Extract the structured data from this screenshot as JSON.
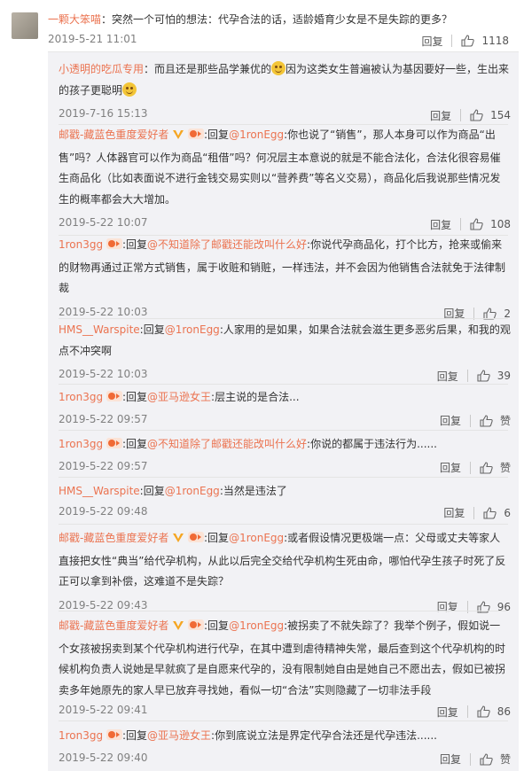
{
  "top": {
    "author": "一颗大笨喵",
    "text": "：突然一个可怕的想法：代孕合法的话，适龄婚育少女是不是失踪的更多？",
    "time": "2019-5-21 11:01",
    "reply_label": "回复",
    "likes": "1118"
  },
  "replies": [
    {
      "author": "小透明的吃瓜专用",
      "pre": "：而且还是那些品学兼优的",
      "mid": "因为这类女生普遍被认为基因要好一些，生出来的孩子更聪明",
      "time": "2019-7-16 15:13",
      "likes": "154"
    },
    {
      "author": "邮戳-藏蓝色重度爱好者",
      "at": "@1ronEgg",
      "text": ":你也说了“销售”，那人本身可以作为商品“出售”吗？人体器官可以作为商品“租借”吗？何况层主本意说的就是不能合法化，合法化很容易催生商品化（比如表面说不进行金钱交易实则以“营养费”等名义交易），商品化后我说那些情况发生的概率都会大大增加。",
      "time": "2019-5-22 10:07",
      "likes": "108"
    },
    {
      "author": "1ron3gg",
      "at": "@不知道除了邮戳还能改叫什么好",
      "text": ":你说代孕商品化，打个比方，抢来或偷来的财物再通过正常方式销售，属于收赃和销赃，一样违法，并不会因为他销售合法就免于法律制裁",
      "time": "2019-5-22 10:03",
      "likes": "2"
    },
    {
      "author": "HMS__Warspite",
      "at": "@1ronEgg",
      "text": ":人家用的是如果，如果合法就会滋生更多恶劣后果，和我的观点不冲突啊",
      "time": "2019-5-22 10:03",
      "likes": "39"
    },
    {
      "author": "1ron3gg",
      "at": "@亚马逊女王",
      "text": ":层主说的是合法...",
      "time": "2019-5-22 09:57",
      "likes": "赞"
    },
    {
      "author": "1ron3gg",
      "at": "@不知道除了邮戳还能改叫什么好",
      "text": ":你说的都属于违法行为......",
      "time": "2019-5-22 09:57",
      "likes": "赞"
    },
    {
      "author": "HMS__Warspite",
      "at": "@1ronEgg",
      "text": ":当然是违法了",
      "time": "2019-5-22 09:48",
      "likes": "6"
    },
    {
      "author": "邮戳-藏蓝色重度爱好者",
      "at": "@1ronEgg",
      "text": ":或者假设情况更极端一点：父母或丈夫等家人直接把女性“典当”给代孕机构，从此以后完全交给代孕机构生死由命，哪怕代孕生孩子时死了反正可以拿到补偿，这难道不是失踪？",
      "time": "2019-5-22 09:43",
      "likes": "96"
    },
    {
      "author": "邮戳-藏蓝色重度爱好者",
      "at": "@1ronEgg",
      "text": ":被拐卖了不就失踪了？我举个例子，假如说一个女孩被拐卖到某个代孕机构进行代孕，在其中遭到虐待精神失常，最后查到这个代孕机构的时候机构负责人说她是早就疯了是自愿来代孕的，没有限制她自由是她自己不愿出去，假如已被拐卖多年她原先的家人早已放弃寻找她，看似一切“合法”实则隐藏了一切非法手段",
      "time": "2019-5-22 09:41",
      "likes": "86"
    },
    {
      "author": "1ron3gg",
      "at": "@亚马逊女王",
      "text": ":你到底说立法是界定代孕合法还是代孕违法......",
      "time": "2019-5-22 09:40",
      "likes": "赞"
    }
  ],
  "labels": {
    "reply": "回复",
    "reply_prefix": "回复"
  },
  "colors": {
    "name": "#eb7350",
    "time": "#808080",
    "panel": "#f2f2f5"
  }
}
